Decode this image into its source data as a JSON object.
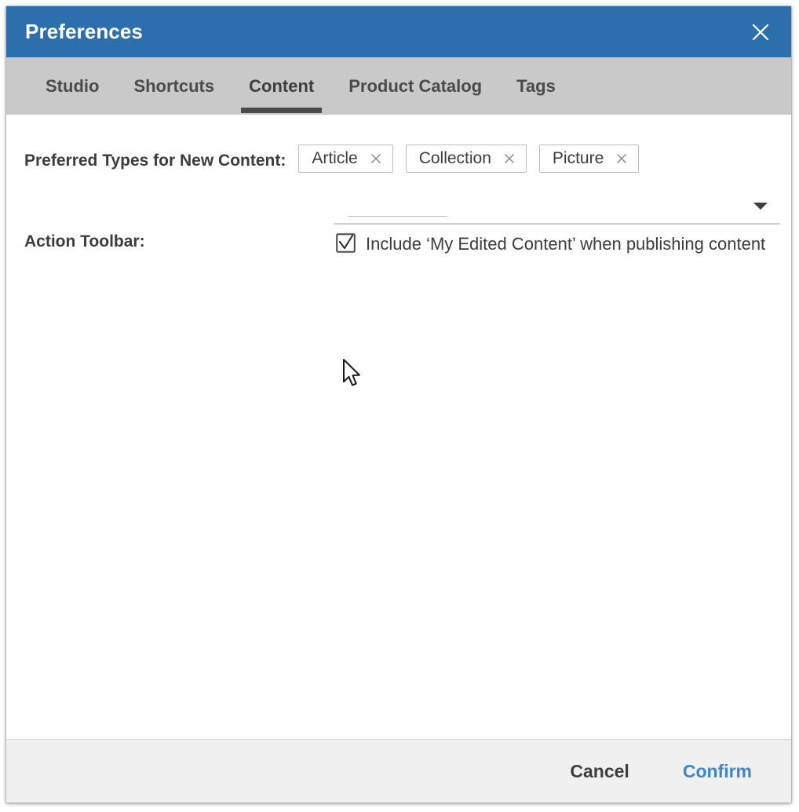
{
  "window": {
    "title": "Preferences",
    "close_icon": "close-icon",
    "titlebar_color": "#2c6fad"
  },
  "tabs": [
    {
      "label": "Studio",
      "active": false
    },
    {
      "label": "Shortcuts",
      "active": false
    },
    {
      "label": "Content",
      "active": true
    },
    {
      "label": "Product Catalog",
      "active": false
    },
    {
      "label": "Tags",
      "active": false
    }
  ],
  "form": {
    "preferred_types": {
      "label": "Preferred Types for New Content:",
      "chips": [
        {
          "label": "Article",
          "remove_icon": "close-icon"
        },
        {
          "label": "Collection",
          "remove_icon": "close-icon"
        },
        {
          "label": "Picture",
          "remove_icon": "close-icon"
        }
      ],
      "select": {
        "value": "",
        "placeholder": "",
        "caret_icon": "chevron-down-icon"
      }
    },
    "action_toolbar": {
      "label": "Action Toolbar:",
      "checkbox": {
        "label": "Include ‘My Edited Content’ when publishing content",
        "checked": true
      }
    }
  },
  "footer": {
    "cancel_label": "Cancel",
    "confirm_label": "Confirm",
    "confirm_color": "#3a87cd"
  }
}
